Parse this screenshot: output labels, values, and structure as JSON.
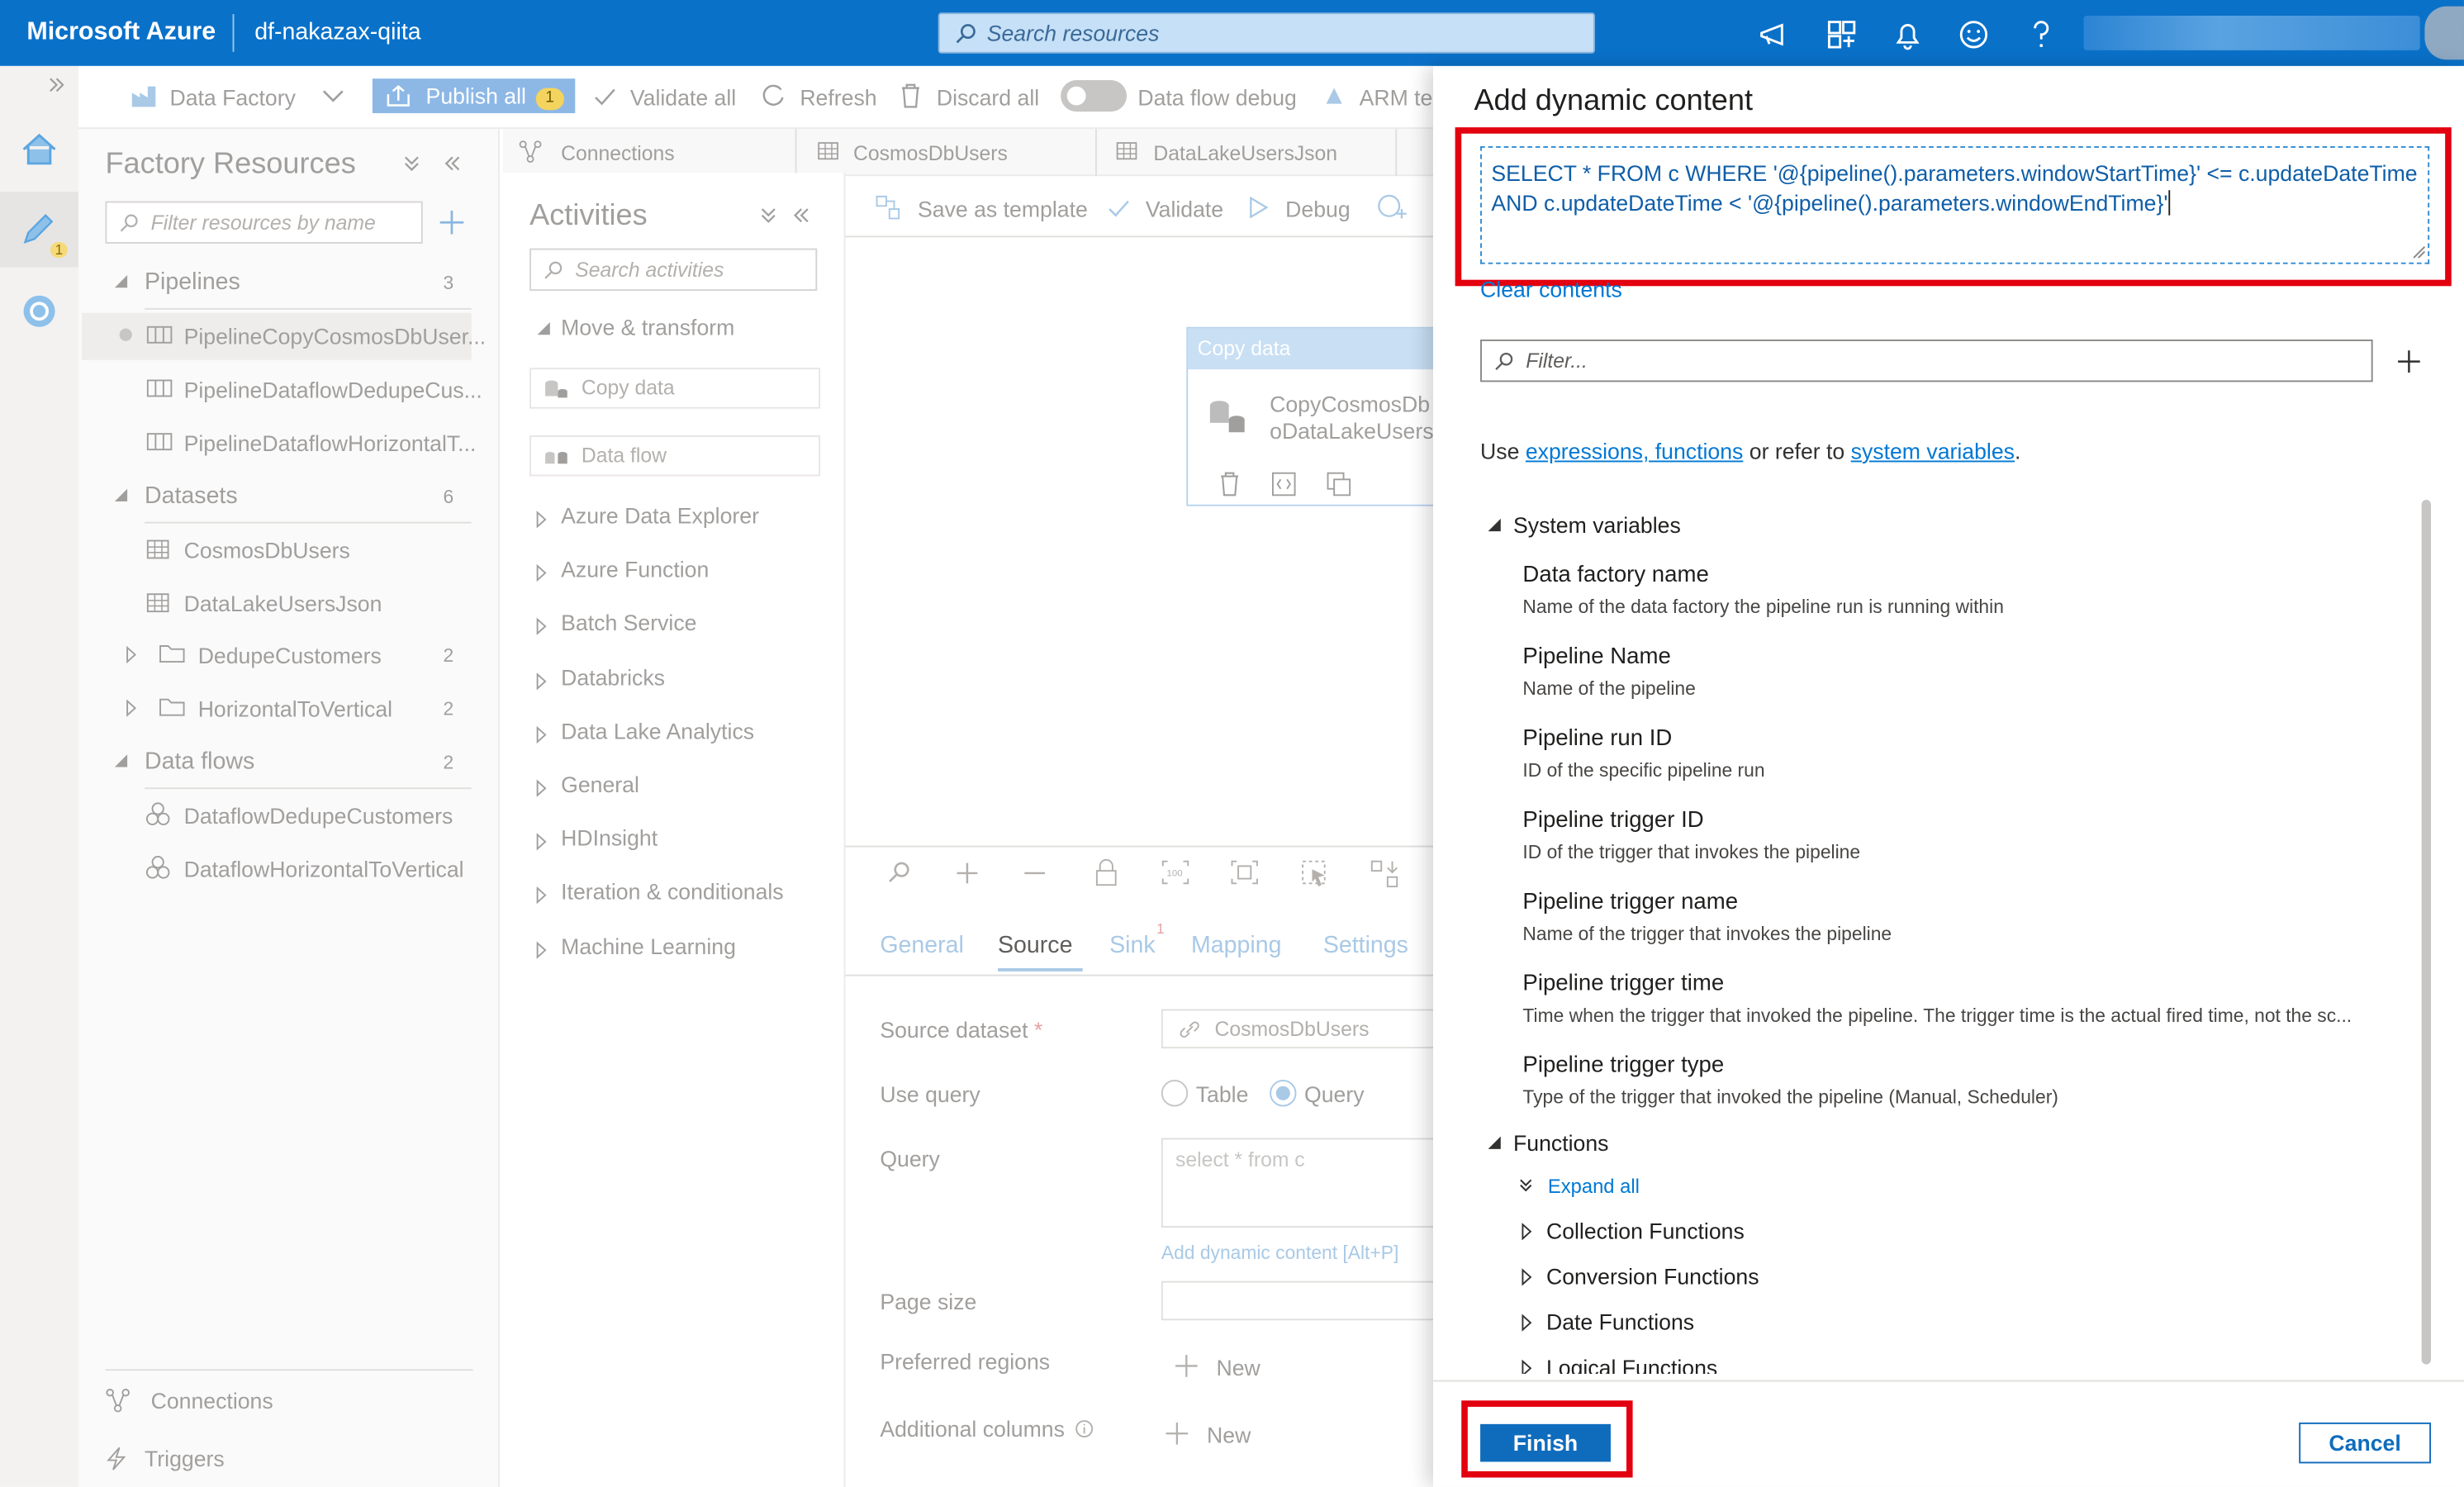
{
  "topbar": {
    "brand": "Microsoft Azure",
    "tenant": "df-nakazax-qiita",
    "search_placeholder": "Search resources",
    "icons": [
      "feedback-icon",
      "directory-icon",
      "bell-icon",
      "smiley-icon",
      "help-icon"
    ]
  },
  "factory_toolbar": {
    "data_factory": "Data Factory",
    "publish_all": "Publish all",
    "publish_badge": "1",
    "validate_all": "Validate all",
    "refresh": "Refresh",
    "discard_all": "Discard all",
    "data_flow_debug": "Data flow debug",
    "arm": "ARM te"
  },
  "left_rail": {
    "author_badge": "1"
  },
  "factory_resources": {
    "title": "Factory Resources",
    "filter_placeholder": "Filter resources by name",
    "pipelines": {
      "label": "Pipelines",
      "count": "3",
      "items": [
        "PipelineCopyCosmosDbUser...",
        "PipelineDataflowDedupeCus...",
        "PipelineDataflowHorizontalT..."
      ]
    },
    "datasets": {
      "label": "Datasets",
      "count": "6",
      "items": [
        "CosmosDbUsers",
        "DataLakeUsersJson"
      ],
      "folders": [
        {
          "label": "DedupeCustomers",
          "count": "2"
        },
        {
          "label": "HorizontalToVertical",
          "count": "2"
        }
      ]
    },
    "dataflows": {
      "label": "Data flows",
      "count": "2",
      "items": [
        "DataflowDedupeCustomers",
        "DataflowHorizontalToVertical"
      ]
    },
    "connections": "Connections",
    "triggers": "Triggers"
  },
  "editor_tabs": [
    "Connections",
    "CosmosDbUsers",
    "DataLakeUsersJson"
  ],
  "activities": {
    "title": "Activities",
    "search_placeholder": "Search activities",
    "move_transform": "Move & transform",
    "copy_data": "Copy data",
    "data_flow": "Data flow",
    "groups": [
      "Azure Data Explorer",
      "Azure Function",
      "Batch Service",
      "Databricks",
      "Data Lake Analytics",
      "General",
      "HDInsight",
      "Iteration & conditionals",
      "Machine Learning"
    ]
  },
  "canvas": {
    "save_as_template": "Save as template",
    "validate": "Validate",
    "debug": "Debug",
    "card_header": "Copy data",
    "card_line1": "CopyCosmosDb",
    "card_line2": "oDataLakeUsers"
  },
  "properties": {
    "tabs": [
      "General",
      "Source",
      "Sink",
      "Mapping",
      "Settings"
    ],
    "sink_badge": "1",
    "source_dataset_label": "Source dataset",
    "source_dataset_value": "CosmosDbUsers",
    "use_query_label": "Use query",
    "option_table": "Table",
    "option_query": "Query",
    "query_label": "Query",
    "query_placeholder": "select * from c",
    "add_dynamic": "Add dynamic content [Alt+P]",
    "page_size_label": "Page size",
    "preferred_regions_label": "Preferred regions",
    "additional_columns_label": "Additional columns",
    "new": "New"
  },
  "dialog": {
    "title": "Add dynamic content",
    "query_text": "SELECT * FROM c WHERE '@{pipeline().parameters.windowStartTime}' <= c.updateDateTime AND c.updateDateTime < '@{pipeline().parameters.windowEndTime}'",
    "clear_contents": "Clear contents",
    "filter_placeholder": "Filter...",
    "use_prefix": "Use ",
    "link_expr": "expressions, functions",
    "use_mid": " or refer to ",
    "link_sysvars": "system variables",
    "use_suffix": ".",
    "system_variables": "System variables",
    "variables": [
      {
        "name": "Data factory name",
        "desc": "Name of the data factory the pipeline run is running within"
      },
      {
        "name": "Pipeline Name",
        "desc": "Name of the pipeline"
      },
      {
        "name": "Pipeline run ID",
        "desc": "ID of the specific pipeline run"
      },
      {
        "name": "Pipeline trigger ID",
        "desc": "ID of the trigger that invokes the pipeline"
      },
      {
        "name": "Pipeline trigger name",
        "desc": "Name of the trigger that invokes the pipeline"
      },
      {
        "name": "Pipeline trigger time",
        "desc": "Time when the trigger that invoked the pipeline. The trigger time is the actual fired time, not the sc..."
      },
      {
        "name": "Pipeline trigger type",
        "desc": "Type of the trigger that invoked the pipeline (Manual, Scheduler)"
      }
    ],
    "functions": "Functions",
    "expand_all": "Expand all",
    "function_groups": [
      "Collection Functions",
      "Conversion Functions",
      "Date Functions",
      "Logical Functions"
    ],
    "finish": "Finish",
    "cancel": "Cancel"
  },
  "colors": {
    "azure_blue": "#0a71c9",
    "highlight_red": "#e3000f",
    "primary_button": "#0f6cbd"
  }
}
